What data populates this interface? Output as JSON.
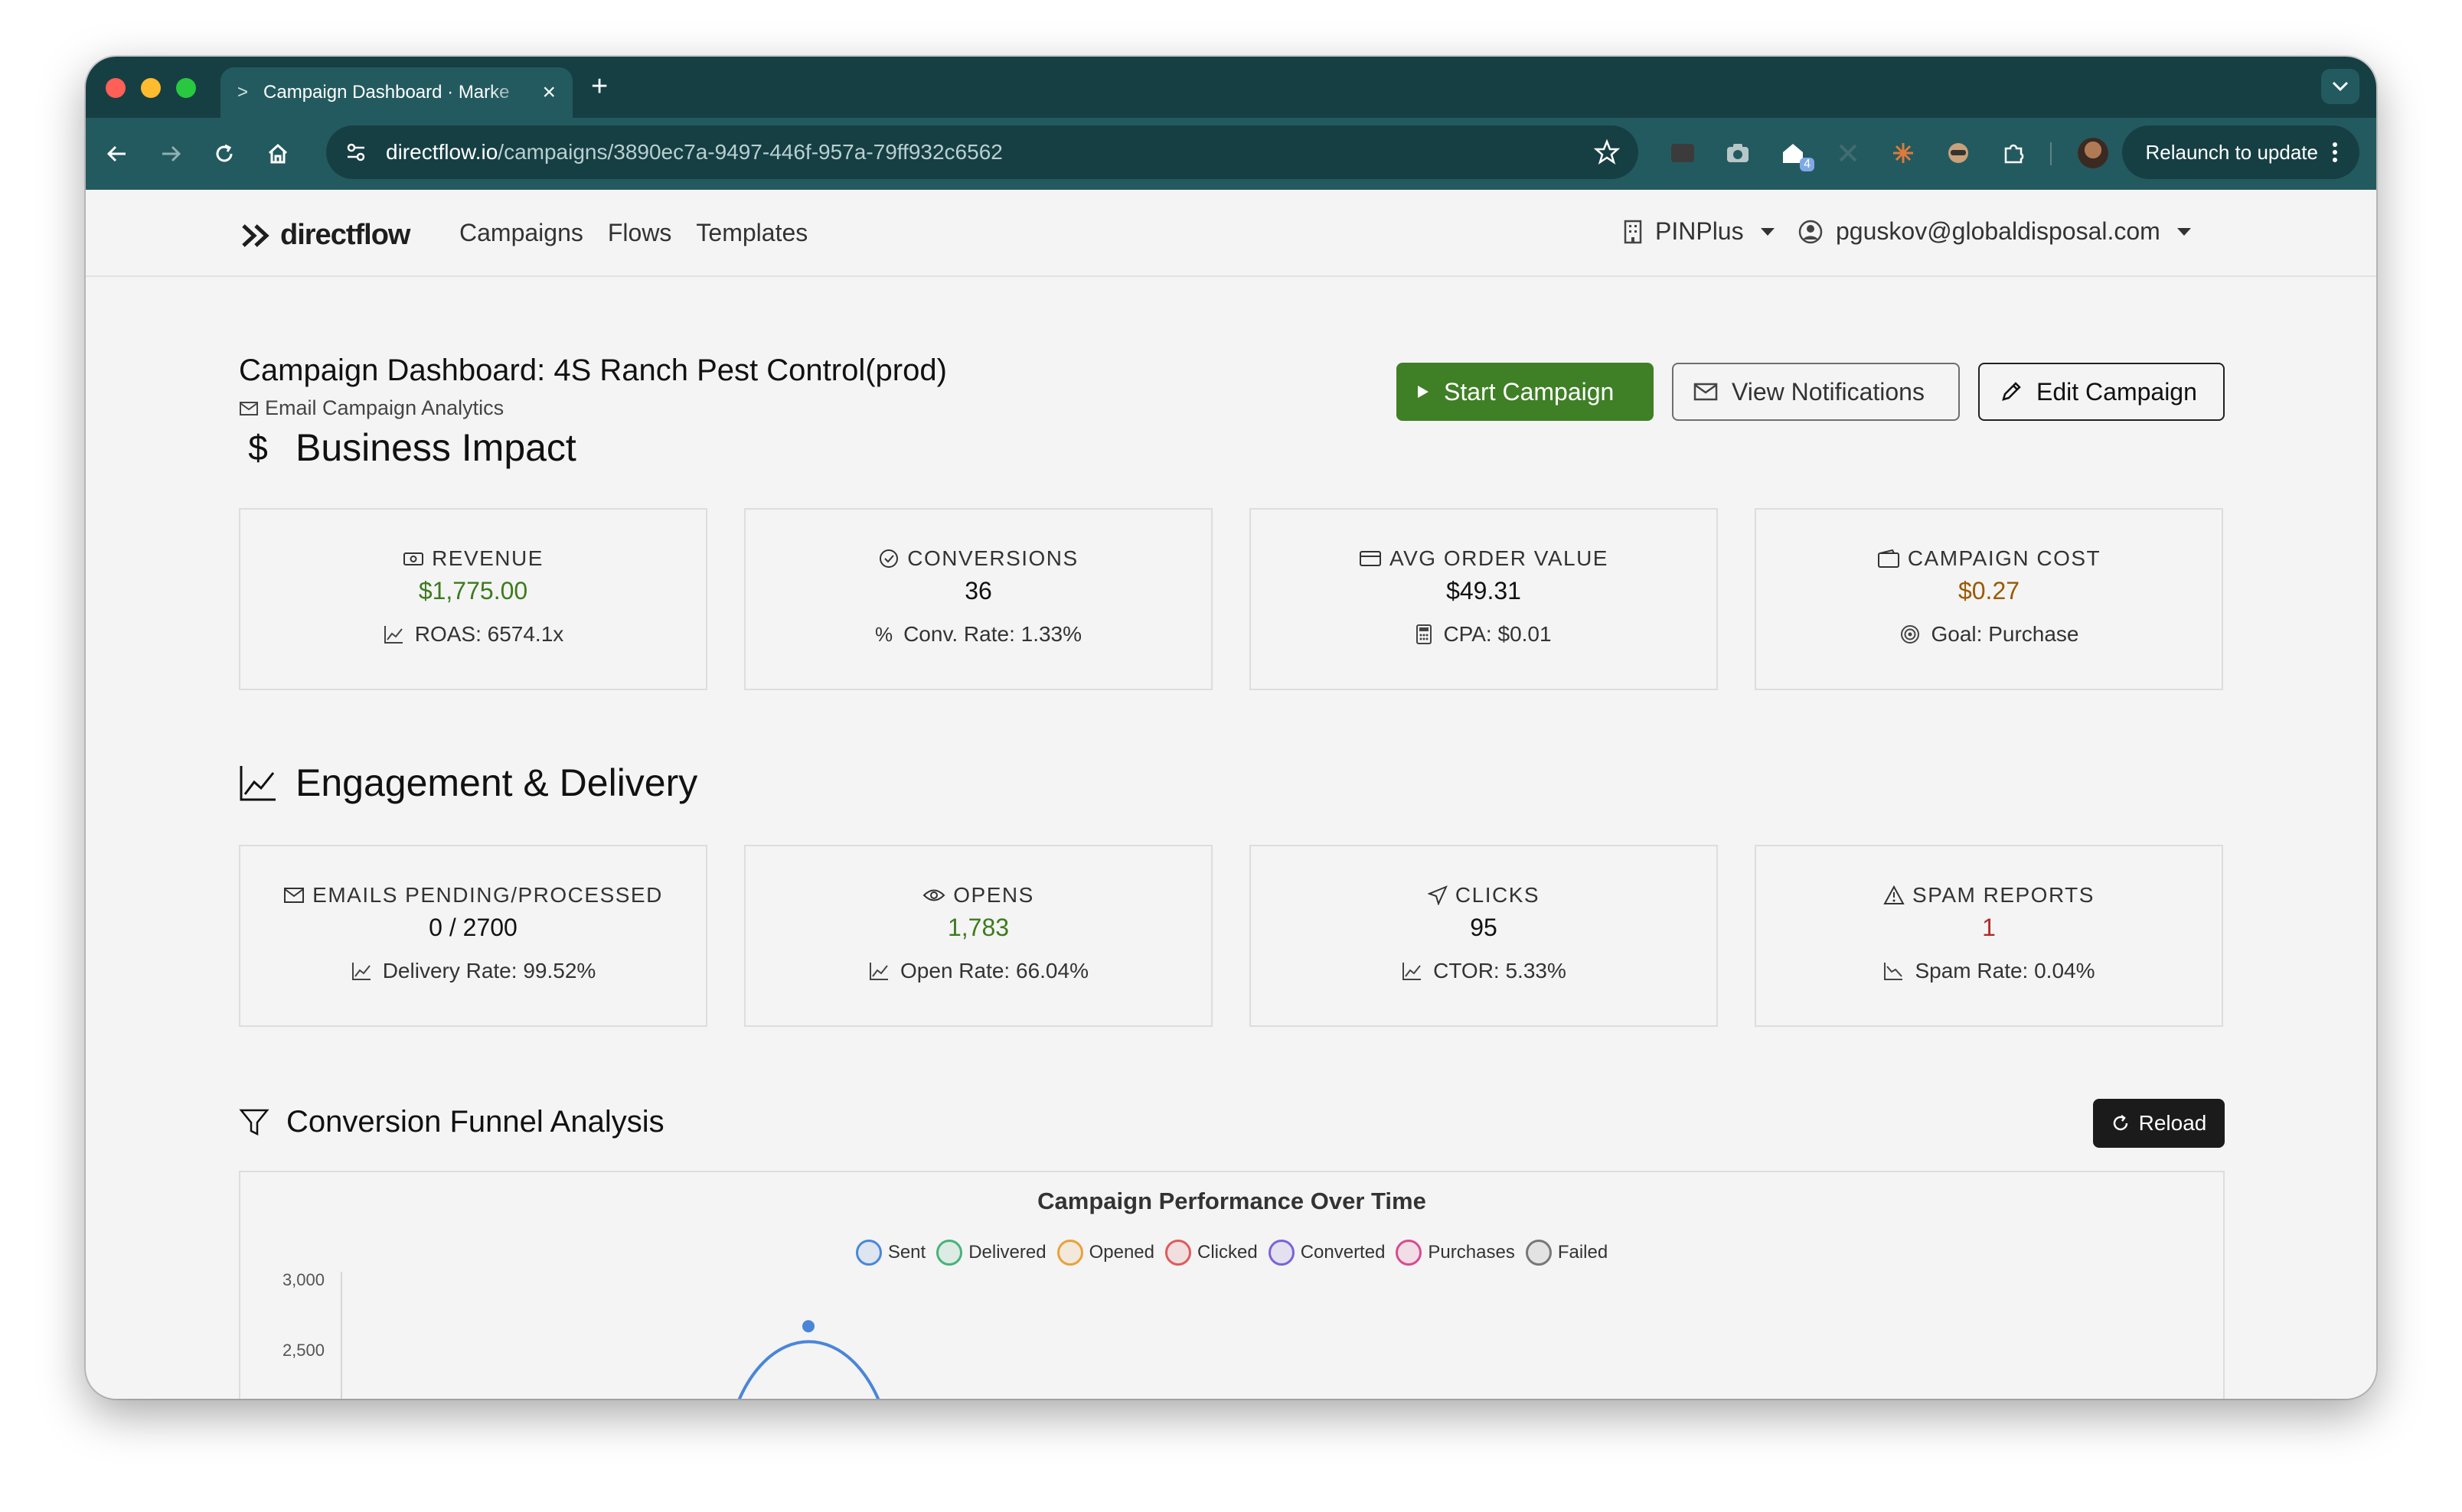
{
  "browser": {
    "tab_title": "Campaign Dashboard · Marke",
    "url_host": "directflow.io",
    "url_path": "/campaigns/3890ec7a-9497-446f-957a-79ff932c6562",
    "relaunch_label": "Relaunch to update",
    "extension_badge": "4"
  },
  "app": {
    "logo_text": "directflow",
    "nav": [
      "Campaigns",
      "Flows",
      "Templates"
    ],
    "org_name": "PINPlus",
    "user_email": "pguskov@globaldisposal.com"
  },
  "page": {
    "title": "Campaign Dashboard: 4S Ranch Pest Control(prod)",
    "subtitle": "Email Campaign Analytics",
    "buttons": {
      "start": "Start Campaign",
      "notifications": "View Notifications",
      "edit": "Edit Campaign"
    }
  },
  "business_impact": {
    "heading": "Business Impact",
    "heading_symbol": "$",
    "cards": [
      {
        "label": "REVENUE",
        "value": "$1,775.00",
        "value_color": "#3d7a1e",
        "sub": "ROAS: 6574.1x",
        "icon": "cash-icon",
        "sub_icon": "trend-icon"
      },
      {
        "label": "CONVERSIONS",
        "value": "36",
        "value_color": "#111111",
        "sub": "Conv. Rate: 1.33%",
        "icon": "check-circle-icon",
        "sub_icon": "percent-icon"
      },
      {
        "label": "AVG ORDER VALUE",
        "value": "$49.31",
        "value_color": "#111111",
        "sub": "CPA: $0.01",
        "icon": "credit-card-icon",
        "sub_icon": "calculator-icon"
      },
      {
        "label": "CAMPAIGN COST",
        "value": "$0.27",
        "value_color": "#9a5a00",
        "sub": "Goal: Purchase",
        "icon": "wallet-icon",
        "sub_icon": "target-icon"
      }
    ]
  },
  "engagement": {
    "heading": "Engagement & Delivery",
    "cards": [
      {
        "label": "EMAILS PENDING/PROCESSED",
        "value": "0 / 2700",
        "value_color": "#111111",
        "sub": "Delivery Rate: 99.52%",
        "icon": "envelope-icon",
        "sub_icon": "trend-icon"
      },
      {
        "label": "OPENS",
        "value": "1,783",
        "value_color": "#3d7a1e",
        "sub": "Open Rate: 66.04%",
        "icon": "eye-icon",
        "sub_icon": "trend-icon"
      },
      {
        "label": "CLICKS",
        "value": "95",
        "value_color": "#111111",
        "sub": "CTOR: 5.33%",
        "icon": "cursor-icon",
        "sub_icon": "trend-icon"
      },
      {
        "label": "SPAM REPORTS",
        "value": "1",
        "value_color": "#b02a2a",
        "sub": "Spam Rate: 0.04%",
        "icon": "warning-icon",
        "sub_icon": "trend-down-icon"
      }
    ]
  },
  "funnel": {
    "heading": "Conversion Funnel Analysis",
    "reload_label": "Reload"
  },
  "chart_data": {
    "type": "line",
    "title": "Campaign Performance Over Time",
    "legend_position": "top",
    "series": [
      {
        "name": "Sent",
        "color": "#4a86d8"
      },
      {
        "name": "Delivered",
        "color": "#47b27a"
      },
      {
        "name": "Opened",
        "color": "#e8a23a"
      },
      {
        "name": "Clicked",
        "color": "#e05a5a"
      },
      {
        "name": "Converted",
        "color": "#7b62d9"
      },
      {
        "name": "Purchases",
        "color": "#d94a8f"
      },
      {
        "name": "Failed",
        "color": "#777777"
      }
    ],
    "y_ticks": [
      "3,000",
      "2,500"
    ],
    "ylim_visible": [
      2300,
      3000
    ],
    "visible_peak": {
      "series": "Sent",
      "y": 2700
    }
  }
}
